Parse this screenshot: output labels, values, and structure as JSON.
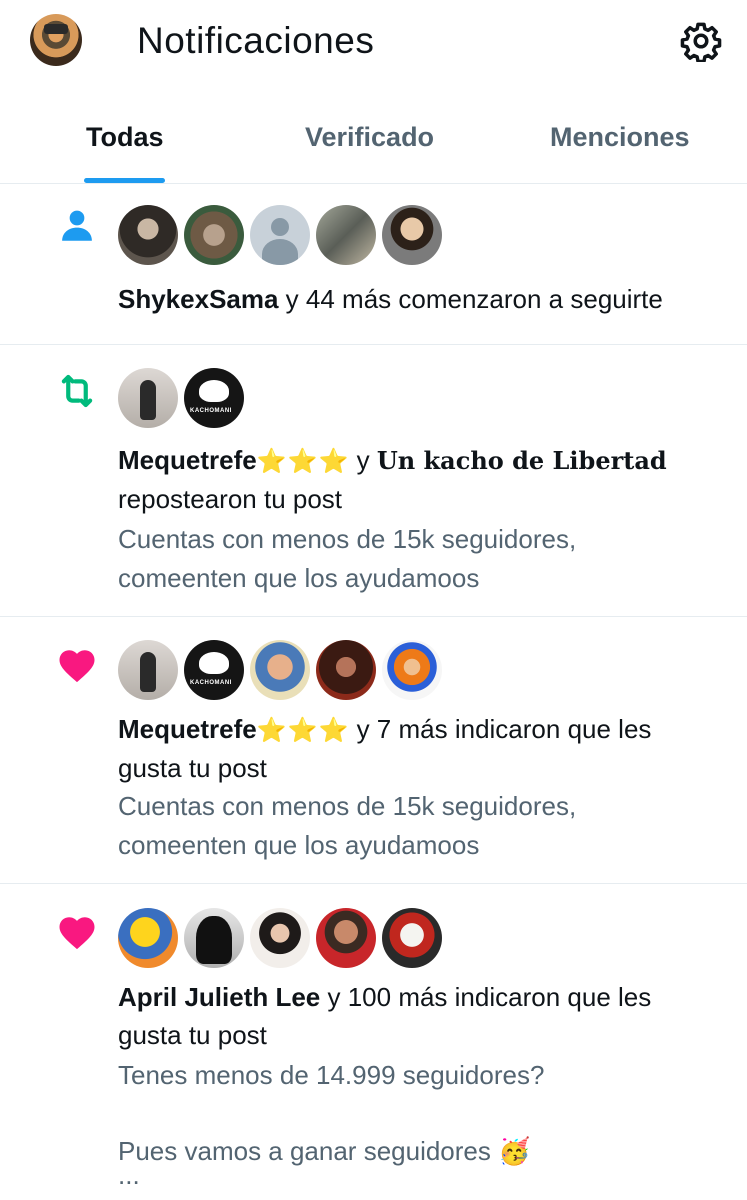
{
  "header": {
    "title": "Notificaciones",
    "avatar_icon": "profile-avatar",
    "settings_icon": "gear-icon"
  },
  "tabs": [
    {
      "label": "Todas",
      "active": true
    },
    {
      "label": "Verificado",
      "active": false
    },
    {
      "label": "Menciones",
      "active": false
    }
  ],
  "colors": {
    "accent": "#1d9bf0",
    "follow": "#1d9bf0",
    "repost": "#00ba7c",
    "like": "#f91880",
    "secondary_text": "#536471"
  },
  "notifications": [
    {
      "type": "follow",
      "icon": "person-icon",
      "actor": "ShykexSama",
      "rest": " y 44 más comenzaron a seguirte"
    },
    {
      "type": "repost",
      "icon": "repost-icon",
      "actor": "Mequetrefe",
      "actor_stars": "⭐⭐⭐",
      "connector": " y ",
      "second_actor": "Un kacho de Libertad",
      "line2": "repostearon tu post",
      "snippet": [
        "Cuentas con menos de 15k seguidores,",
        "comeenten que los ayudamoos"
      ]
    },
    {
      "type": "like",
      "icon": "heart-icon",
      "actor": "Mequetrefe",
      "actor_stars": "⭐⭐⭐",
      "rest": " y 7 más indicaron que les",
      "line2": "gusta tu post",
      "snippet": [
        "Cuentas con menos de 15k seguidores,",
        "comeenten que los ayudamoos"
      ]
    },
    {
      "type": "like",
      "icon": "heart-icon",
      "actor": "April Julieth Lee",
      "rest": " y 100 más indicaron que les",
      "line2": "gusta tu post",
      "snippet": [
        "Tenes menos de 14.999 seguidores?",
        "Pues vamos a ganar seguidores 🥳",
        "..."
      ]
    }
  ]
}
